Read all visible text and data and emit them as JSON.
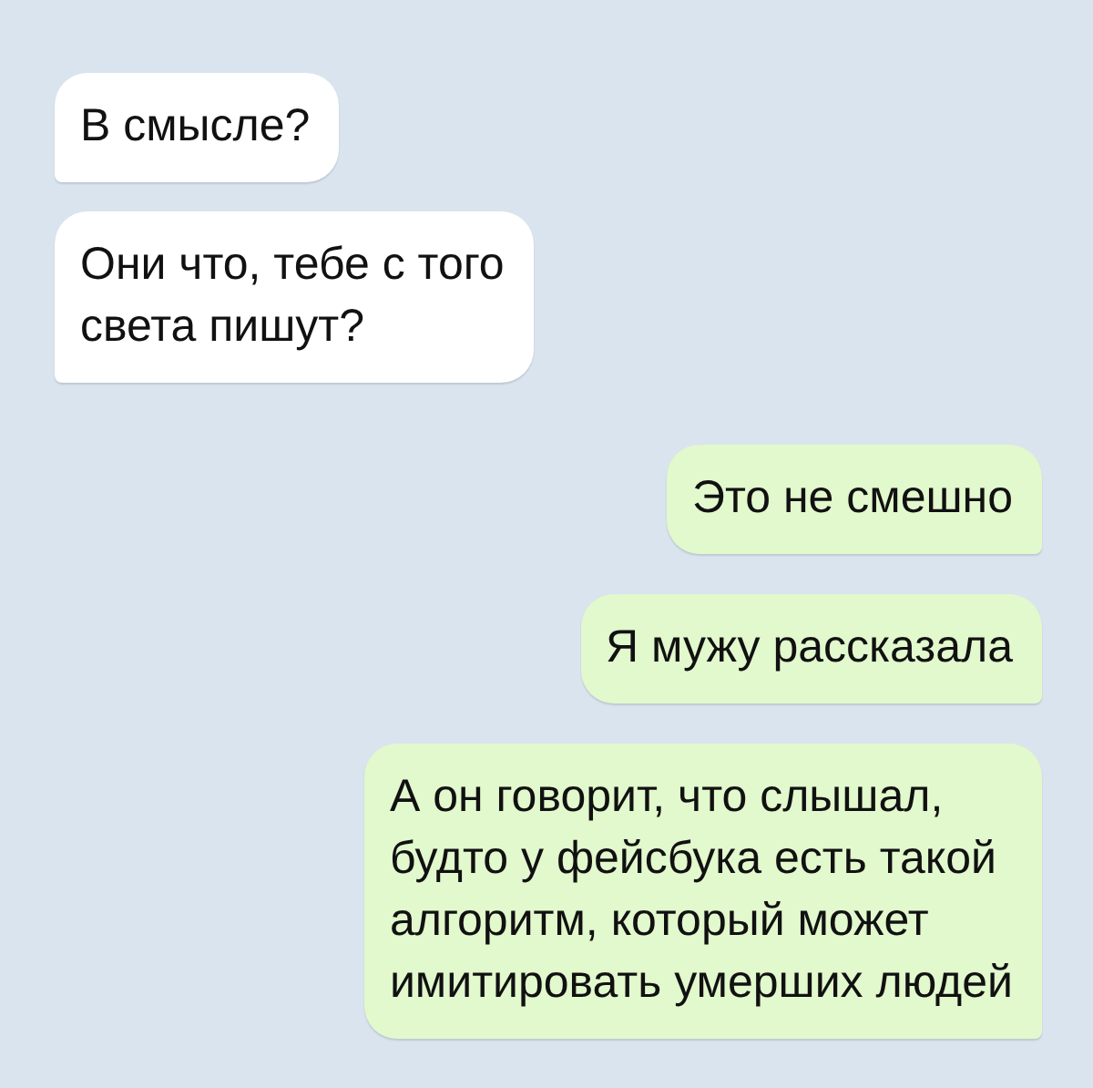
{
  "messages": [
    {
      "kind": "incoming",
      "text": "В смысле?"
    },
    {
      "kind": "incoming",
      "text": "Они что, тебе с того\nсвета пишут?"
    },
    {
      "kind": "outgoing",
      "text": "Это не смешно"
    },
    {
      "kind": "outgoing",
      "text": "Я мужу рассказала"
    },
    {
      "kind": "outgoing",
      "text": "А он говорит, что слышал,\nбудто у фейсбука есть такой\nалгоритм, который может\nимитировать умерших людей"
    }
  ]
}
